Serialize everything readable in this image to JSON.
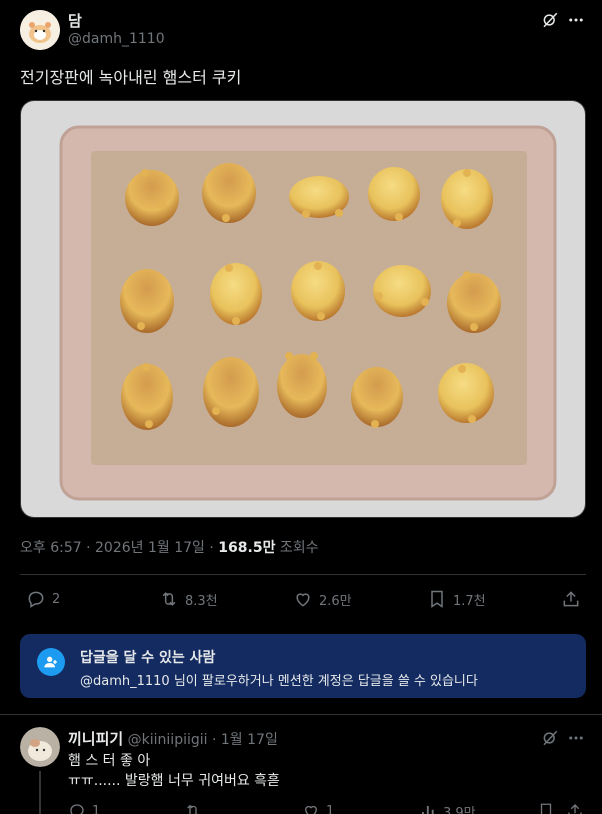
{
  "post": {
    "author_name": "담",
    "author_handle": "@damh_1110",
    "text": "전기장판에 녹아내린 햄스터 쿠키",
    "time": "오후 6:57",
    "sep1": "·",
    "date": "2026년 1월 17일",
    "sep2": "·",
    "views_count": "168.5만",
    "views_label": "조회수",
    "actions": {
      "replies": "2",
      "reposts": "8.3천",
      "likes": "2.6만",
      "bookmarks": "1.7천"
    },
    "image_alt": "Baking tray with 15 hamster-shaped cookies"
  },
  "reply_notice": {
    "title": "답글을 달 수 있는 사람",
    "handle": "@damh_1110",
    "body": " 님이 팔로우하거나 멘션한 계정은 답글을 쓸 수 있습니다"
  },
  "reply": {
    "author_name": "끼니피기",
    "author_handle": "@kiiniipiigii",
    "sep": "·",
    "date": "1월 17일",
    "line1": "햄 스 터 좋 아",
    "line2": "ㅠㅠ...... 발랑햄 너무 귀여버요 흑흗",
    "actions": {
      "replies": "1",
      "likes": "1",
      "views": "3.9만"
    }
  },
  "colors": {
    "background": "#000000",
    "text": "#e7e9ea",
    "muted": "#71767b",
    "divider": "#2f3336",
    "notice_bg": "#132b60",
    "accent": "#1d9bf0"
  },
  "icons": [
    "grok-icon",
    "more-icon",
    "reply-icon",
    "repost-icon",
    "like-icon",
    "bookmark-icon",
    "share-icon",
    "person-icon",
    "views-icon"
  ]
}
